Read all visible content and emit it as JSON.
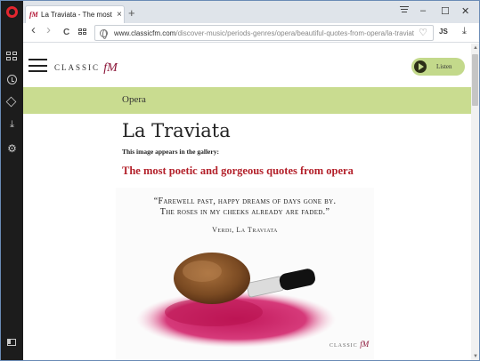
{
  "browser": {
    "tab_title": "La Traviata - The most poe",
    "tab_favicon": "fM",
    "new_tab": "+",
    "tab_close": "×",
    "minimize": "–",
    "maximize": "☐",
    "close": "✕",
    "back": "‹",
    "forward": "›",
    "reload": "C",
    "url_host": "www.classicfm.com",
    "url_path": "/discover-music/periods-genres/opera/beautiful-quotes-from-opera/la-traviat",
    "js_label": "JS",
    "download": "⤓",
    "heart": "♡"
  },
  "site": {
    "brand": "CLASSIC",
    "brand_fm": "fM",
    "listen_label": "Listen"
  },
  "page": {
    "category": "Opera",
    "title": "La Traviata",
    "gallery_note": "This image appears in the gallery:",
    "gallery_link": "The most poetic and gorgeous quotes from opera"
  },
  "quote_image": {
    "line1": "“Farewell past, happy dreams of days gone by.",
    "line2": "The roses in my cheeks already are faded.”",
    "author": "Verdi, La Traviata",
    "logo": "CLASSIC",
    "logo_fm": "fM"
  },
  "colors": {
    "accent_green": "#c9dc90",
    "link_red": "#b3202a",
    "brand_maroon": "#8b1538",
    "sidebar": "#1c1c1c"
  }
}
